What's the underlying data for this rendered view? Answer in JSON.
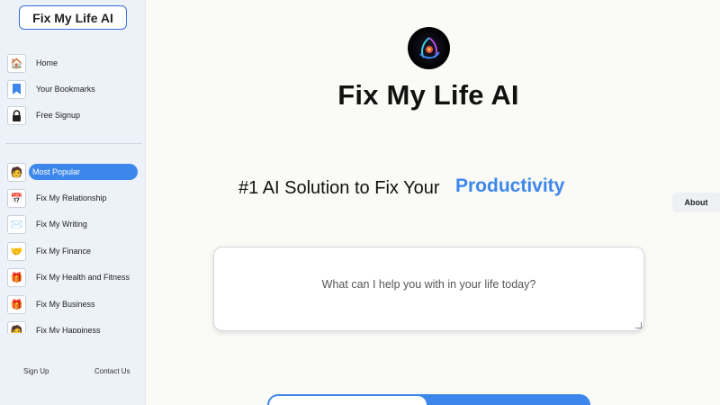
{
  "sidebar": {
    "brand": "Fix My Life AI",
    "top_items": [
      {
        "label": "Home",
        "icon": "🏠"
      },
      {
        "label": "Your Bookmarks",
        "icon": "🔖"
      },
      {
        "label": "Free Signup",
        "icon": "🔒"
      }
    ],
    "category_items": [
      {
        "label": "Most Popular",
        "icon": "🧑"
      },
      {
        "label": "Fix My Relationship",
        "icon": "📅"
      },
      {
        "label": "Fix My Writing",
        "icon": "✉️"
      },
      {
        "label": "Fix My Finance",
        "icon": "🤝"
      },
      {
        "label": "Fix My Health and Fitness",
        "icon": "🎁"
      },
      {
        "label": "Fix My Business",
        "icon": "🎁"
      },
      {
        "label": "Fix My Happiness",
        "icon": "🧑"
      }
    ],
    "footer": {
      "signup": "Sign Up",
      "contact": "Contact Us"
    }
  },
  "main": {
    "title": "Fix My Life AI",
    "headline": "#1 AI Solution to Fix Your",
    "headline_accent": "Productivity",
    "prompt_placeholder": "What can I help you with in your life today?",
    "about_label": "About"
  },
  "colors": {
    "accent": "#3d87ec",
    "sidebar_bg": "#edf1f8",
    "page_bg": "#fafaf7"
  }
}
